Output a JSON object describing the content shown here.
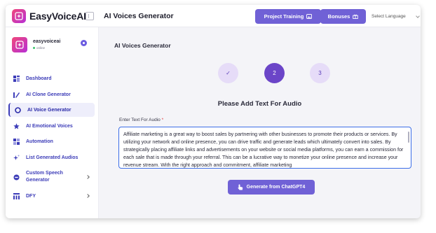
{
  "header": {
    "logo_text": "EasyVoiceAI",
    "title": "AI Voices Generator",
    "project_training_label": "Project Training",
    "bonuses_label": "Bonuses",
    "language_select": "Select Language"
  },
  "profile": {
    "name": "easyvoiceai",
    "status": "online"
  },
  "sidebar": {
    "items": [
      {
        "label": "Dashboard",
        "icon": "dashboard-icon"
      },
      {
        "label": "AI Clone Generator",
        "icon": "clone-icon"
      },
      {
        "label": "AI Voice Generator",
        "icon": "voice-icon",
        "active": true
      },
      {
        "label": "AI Emotional Voices",
        "icon": "star-icon"
      },
      {
        "label": "Automation",
        "icon": "automation-icon"
      },
      {
        "label": "List Generated Audios",
        "icon": "sparkle-icon"
      },
      {
        "label": "Custom Speech Generator",
        "icon": "speech-icon"
      },
      {
        "label": "DFY",
        "icon": "grid-icon"
      }
    ]
  },
  "main": {
    "title": "AI Voices Generator",
    "steps": [
      {
        "label": "✓",
        "state": "done"
      },
      {
        "label": "2",
        "state": "active"
      },
      {
        "label": "3",
        "state": "pending"
      }
    ],
    "section_title": "Please Add Text For Audio",
    "field_label": "Enter Text For Audio",
    "field_required": "*",
    "text_value": "Affiliate marketing is a great way to boost sales by partnering with other businesses to promote their products or services. By utilizing your network and online presence, you can drive traffic and generate leads which ultimately convert into sales. By strategically placing affiliate links and advertisements on your website or social media platforms, you can earn a commission for each sale that is made through your referral. This can be a lucrative way to monetize your online presence and increase your revenue stream. With the right approach and commitment, affiliate marketing",
    "generate_button": "Generate from ChatGPT4"
  },
  "colors": {
    "accent": "#7061d6",
    "step_active": "#6b45c8",
    "step_inactive": "#e6dcf8",
    "nav_text": "#3c3cb8",
    "textarea_border": "#3c6ee8"
  }
}
